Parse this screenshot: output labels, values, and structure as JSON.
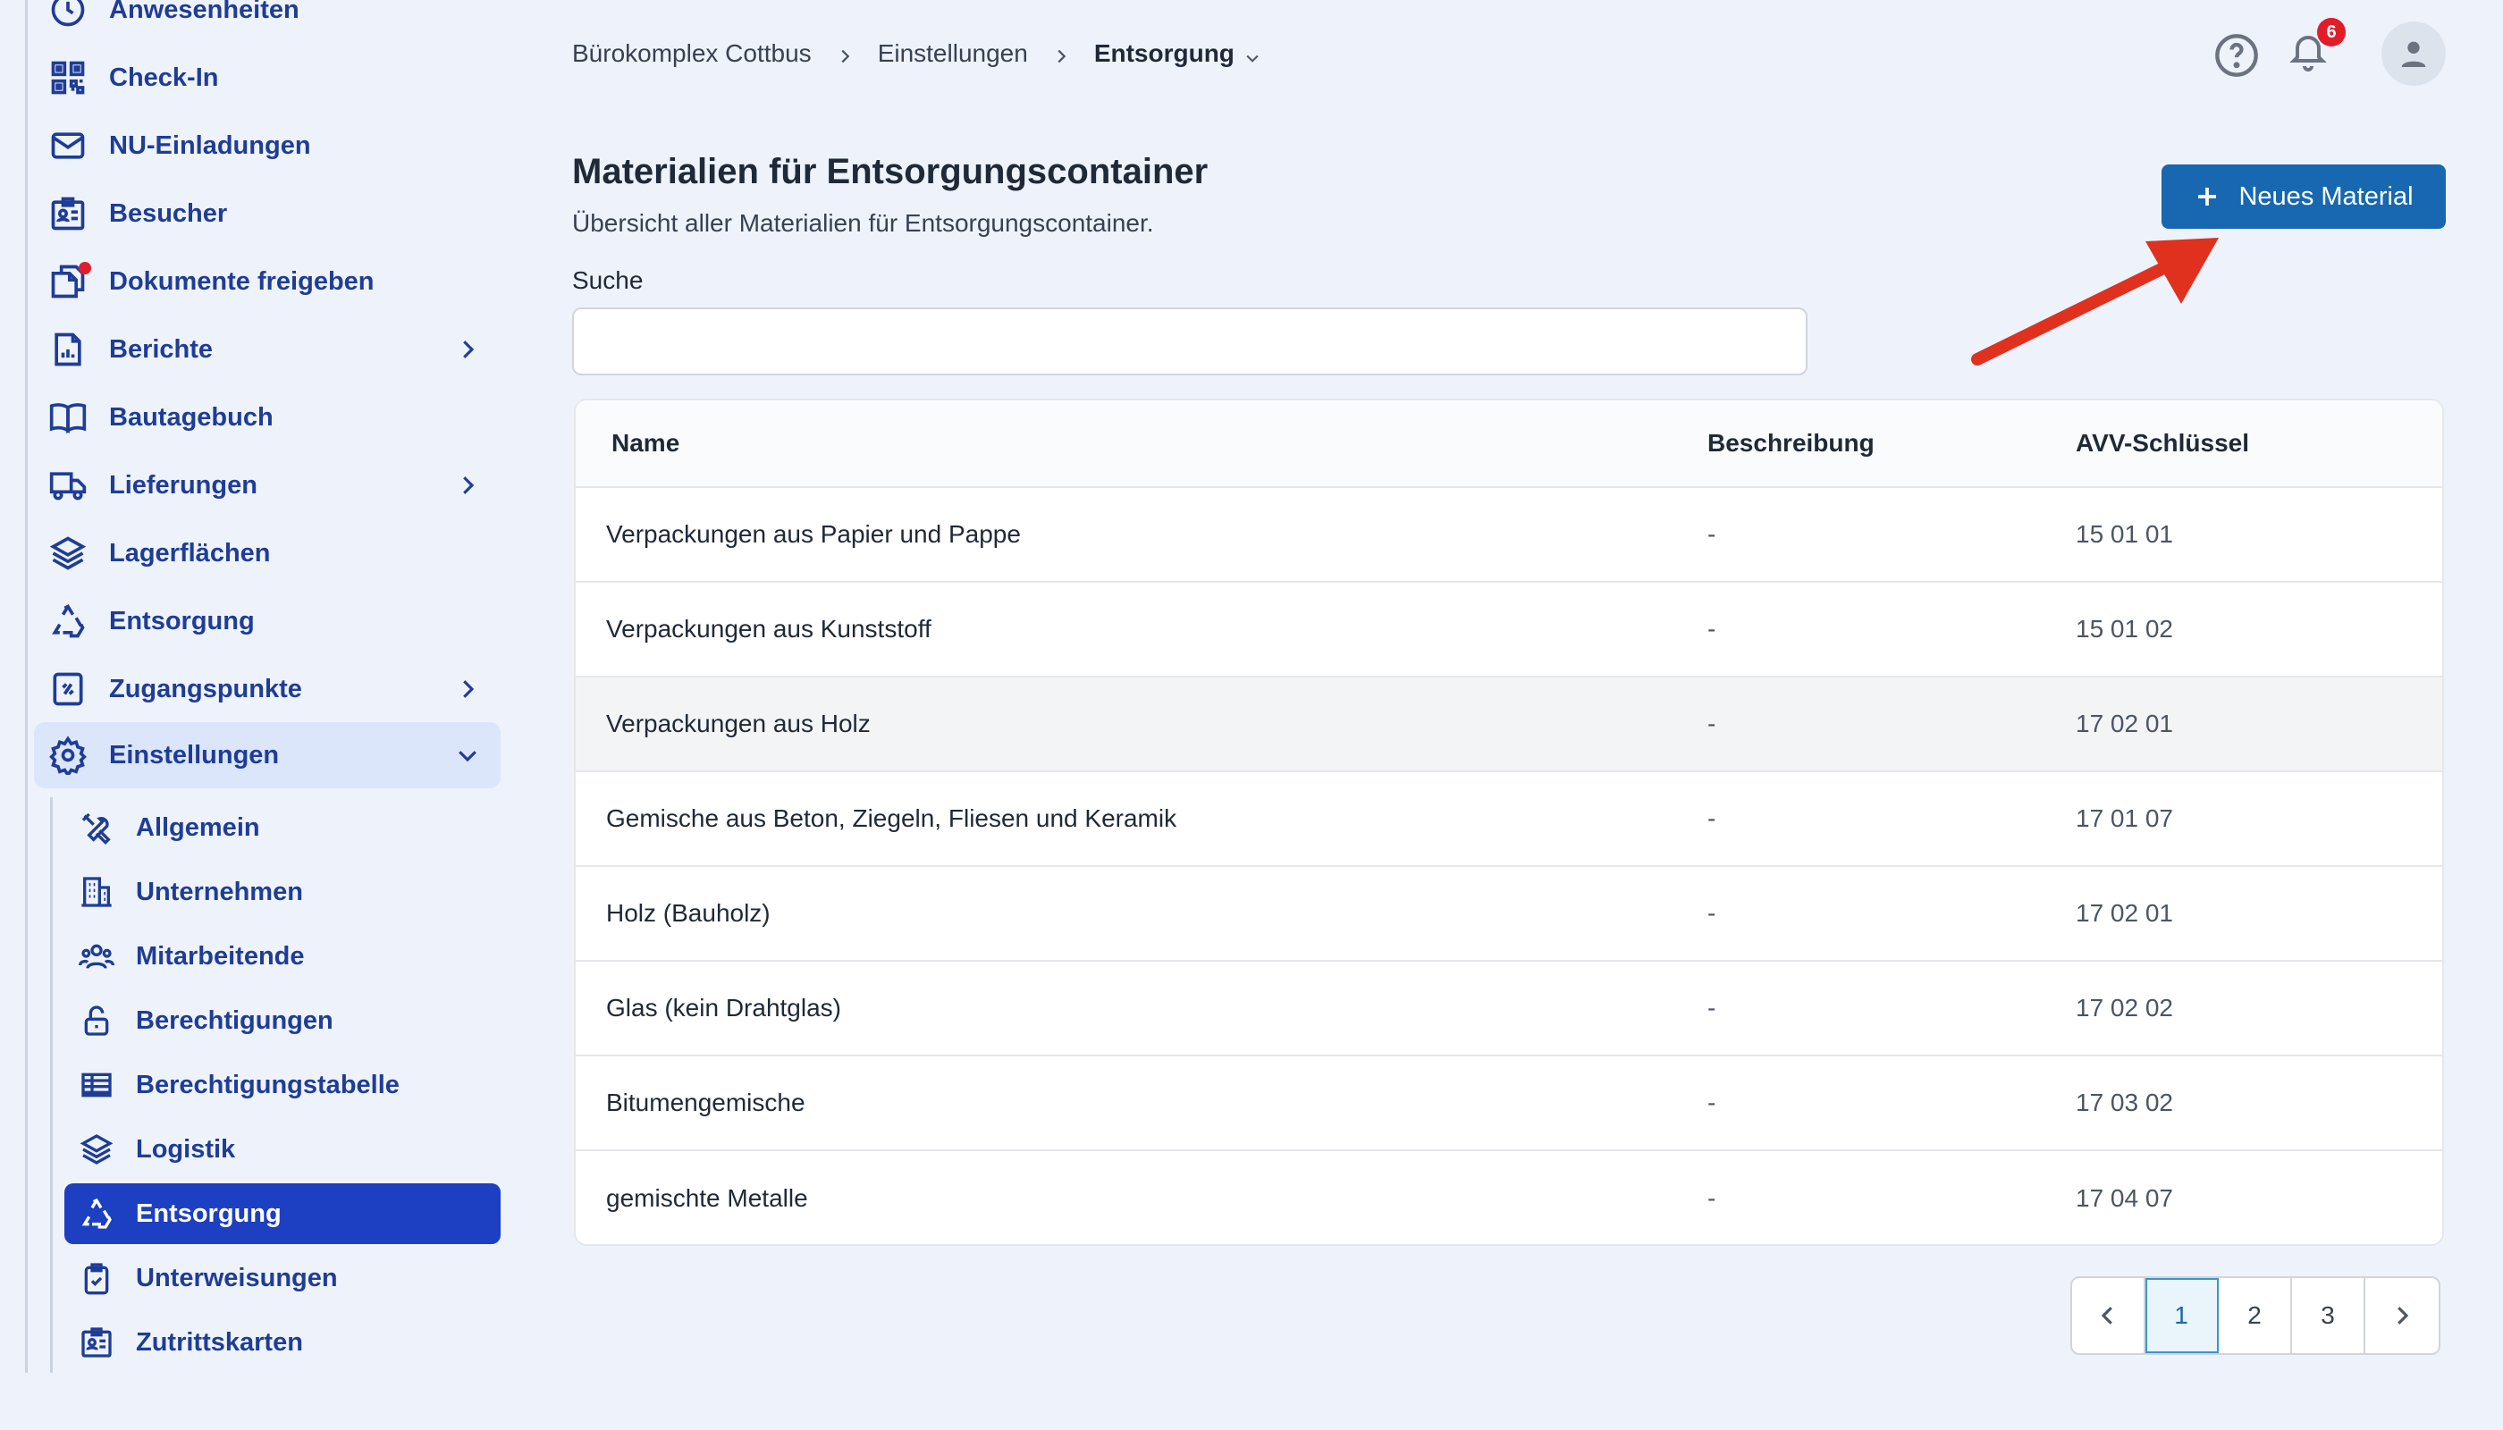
{
  "sidebar": {
    "items": [
      {
        "label": "Anwesenheiten",
        "icon": "clock-icon"
      },
      {
        "label": "Check-In",
        "icon": "qr-code-icon"
      },
      {
        "label": "NU-Einladungen",
        "icon": "envelope-icon"
      },
      {
        "label": "Besucher",
        "icon": "id-card-icon"
      },
      {
        "label": "Dokumente freigeben",
        "icon": "documents-icon"
      },
      {
        "label": "Berichte",
        "icon": "report-icon"
      },
      {
        "label": "Bautagebuch",
        "icon": "book-icon"
      },
      {
        "label": "Lieferungen",
        "icon": "truck-icon"
      },
      {
        "label": "Lagerflächen",
        "icon": "layers-icon"
      },
      {
        "label": "Entsorgung",
        "icon": "recycle-icon"
      },
      {
        "label": "Zugangspunkte",
        "icon": "access-point-icon"
      },
      {
        "label": "Einstellungen",
        "icon": "gear-icon"
      }
    ],
    "subitems": [
      {
        "label": "Allgemein",
        "icon": "tools-icon"
      },
      {
        "label": "Unternehmen",
        "icon": "building-icon"
      },
      {
        "label": "Mitarbeitende",
        "icon": "users-icon"
      },
      {
        "label": "Berechtigungen",
        "icon": "unlock-icon"
      },
      {
        "label": "Berechtigungstabelle",
        "icon": "table-icon"
      },
      {
        "label": "Logistik",
        "icon": "layers-icon"
      },
      {
        "label": "Entsorgung",
        "icon": "recycle-icon"
      },
      {
        "label": "Unterweisungen",
        "icon": "clipboard-check-icon"
      },
      {
        "label": "Zutrittskarten",
        "icon": "id-card-icon"
      }
    ]
  },
  "header": {
    "breadcrumb": [
      "Bürokomplex Cottbus",
      "Einstellungen",
      "Entsorgung"
    ],
    "notification_count": "6"
  },
  "main": {
    "title": "Materialien für Entsorgungscontainer",
    "subtitle": "Übersicht aller Materialien für Entsorgungscontainer.",
    "search_label": "Suche",
    "search_value": "",
    "new_button": "Neues Material"
  },
  "table": {
    "columns": [
      "Name",
      "Beschreibung",
      "AVV-Schlüssel"
    ],
    "rows": [
      {
        "name": "Verpackungen aus Papier und Pappe",
        "desc": "-",
        "avv": "15 01 01"
      },
      {
        "name": "Verpackungen aus Kunststoff",
        "desc": "-",
        "avv": "15 01 02"
      },
      {
        "name": "Verpackungen aus Holz",
        "desc": "-",
        "avv": "17 02 01"
      },
      {
        "name": "Gemische aus Beton, Ziegeln, Fliesen und Keramik",
        "desc": "-",
        "avv": "17 01 07"
      },
      {
        "name": "Holz (Bauholz)",
        "desc": "-",
        "avv": "17 02 01"
      },
      {
        "name": "Glas (kein Drahtglas)",
        "desc": "-",
        "avv": "17 02 02"
      },
      {
        "name": "Bitumengemische",
        "desc": "-",
        "avv": "17 03 02"
      },
      {
        "name": "gemischte Metalle",
        "desc": "-",
        "avv": "17 04 07"
      }
    ]
  },
  "pagination": {
    "pages": [
      "1",
      "2",
      "3"
    ],
    "current": "1"
  },
  "colors": {
    "accent": "#1768b0",
    "nav_active": "#1d3fc1",
    "nav_text": "#1f3d96",
    "badge": "#e11d2a",
    "annotation_arrow": "#e0301e"
  }
}
